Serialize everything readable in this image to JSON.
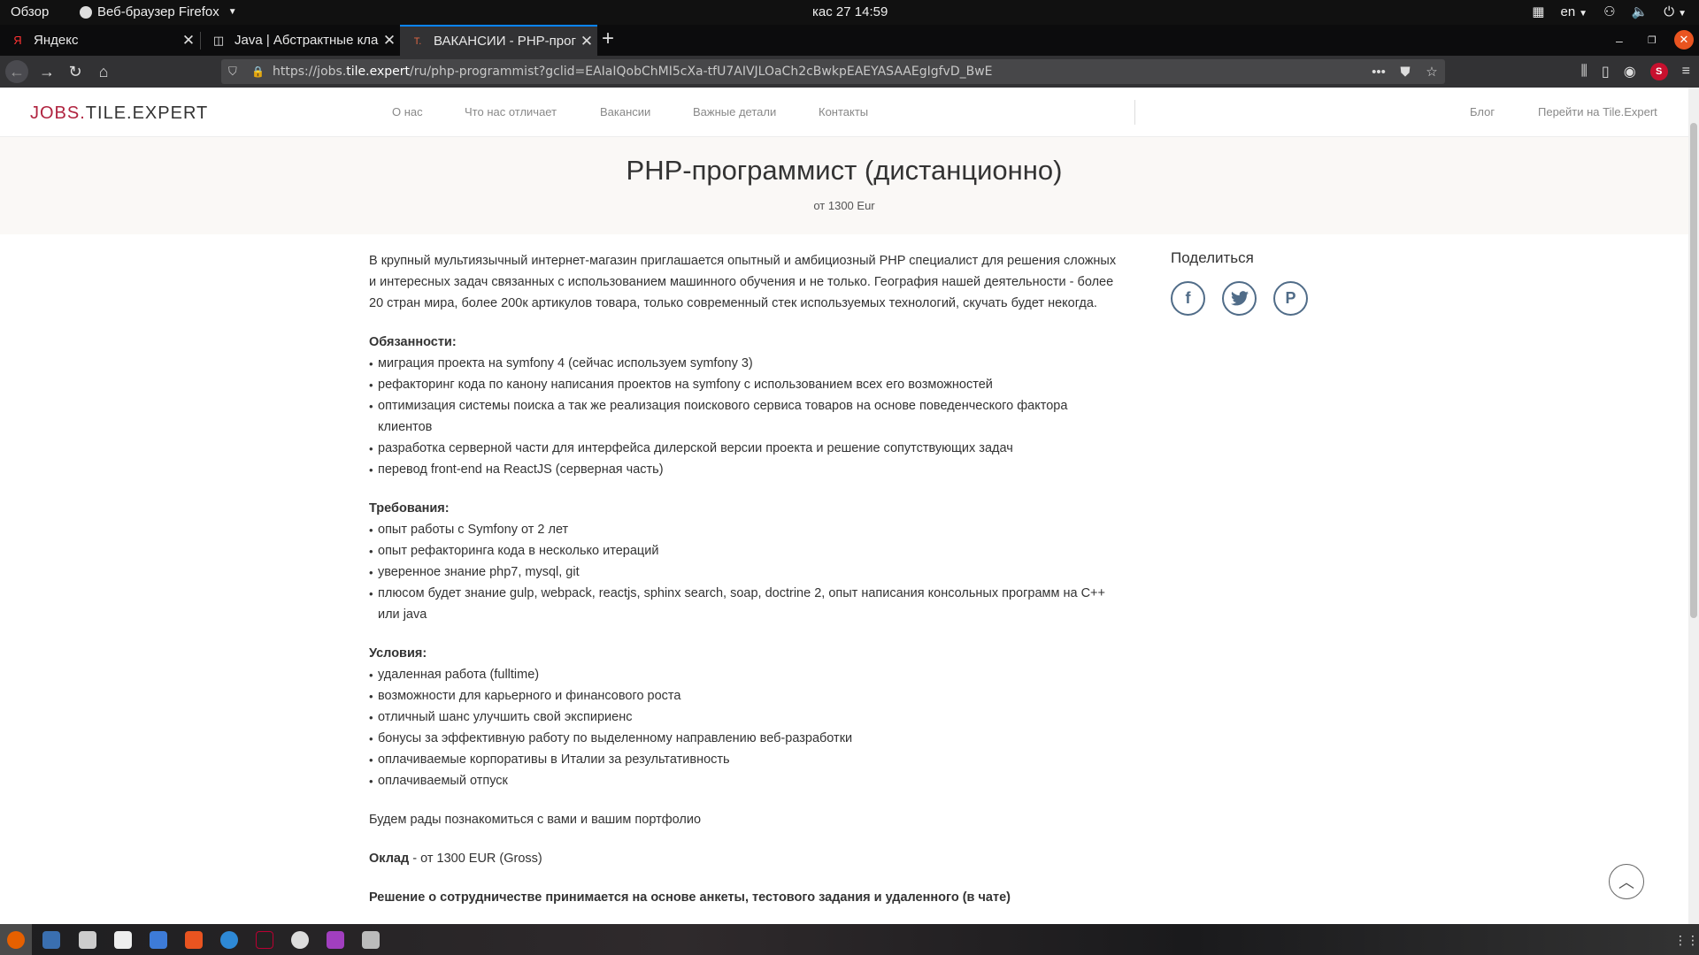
{
  "topbar": {
    "overview": "Обзор",
    "app_name": "Веб-браузер Firefox",
    "clock": "кас 27  14:59",
    "lang": "en"
  },
  "tabs": [
    {
      "title": "Яндекс",
      "favicon": "Я"
    },
    {
      "title": "Java | Абстрактные кла",
      "favicon": "◫"
    },
    {
      "title": "ВАКАНСИИ - PHP-прогр",
      "favicon": "T."
    }
  ],
  "url": {
    "prefix": "https://jobs.",
    "domain": "tile.expert",
    "path": "/ru/php-programmist?gclid=EAIaIQobChMI5cXa-tfU7AIVJLOaCh2cBwkpEAEYASAAEgIgfvD_BwE"
  },
  "site": {
    "logo_left": "JOBS.",
    "logo_right": "TILE.EXPERT",
    "menu": [
      "О нас",
      "Что нас отличает",
      "Вакансии",
      "Важные детали",
      "Контакты"
    ],
    "menu_right": [
      "Блог",
      "Перейти на Tile.Expert"
    ]
  },
  "hero": {
    "title": "PHP-программист (дистанционно)",
    "salary": "от 1300 Eur"
  },
  "content": {
    "intro": "В крупный мультиязычный интернет-магазин приглашается опытный и амбициозный PHP специалист для решения сложных и интересных задач связанных с использованием машинного обучения и не только. География нашей деятельности - более 20 стран мира, более 200к артикулов товара, только современный стек используемых технологий, скучать будет некогда.",
    "duties_title": "Обязанности:",
    "duties": [
      "миграция проекта на symfony 4 (сейчас используем symfony 3)",
      "рефакторинг кода по канону написания проектов на symfony с использованием всех его возможностей",
      "оптимизация системы поиска а так же реализация поискового сервиса товаров на основе поведенческого фактора клиентов",
      "разработка серверной части для интерфейса дилерской версии проекта и решение сопутствующих задач",
      "перевод front-end на ReactJS (серверная часть)"
    ],
    "req_title": "Требования:",
    "requirements": [
      "опыт работы с Symfony от 2 лет",
      "опыт рефакторинга кода в несколько итераций",
      "уверенное знание php7, mysql, git",
      "плюсом будет знание gulp, webpack, reactjs, sphinx search, soap, doctrine 2, опыт написания консольных программ на C++ или java"
    ],
    "cond_title": "Условия:",
    "conditions": [
      "удаленная работа (fulltime)",
      "возможности для карьерного и финансового роста",
      "отличный шанс улучшить свой экспириенс",
      "бонусы за эффективную работу по выделенному направлению веб-разработки",
      "оплачиваемые корпоративы в Италии за результативность",
      "оплачиваемый отпуск"
    ],
    "outro": "Будем рады познакомиться с вами и вашим портфолио",
    "salary_label": "Оклад",
    "salary_value": " - от 1300 EUR (Gross)",
    "decision": "Решение о сотрудничестве принимается на основе анкеты, тестового задания и удаленного (в чате)"
  },
  "share": {
    "title": "Поделиться",
    "icons": [
      "facebook-icon",
      "twitter-icon",
      "pinterest-icon"
    ]
  },
  "colors": {
    "accent": "#0a84ff",
    "brand": "#b0233f",
    "share": "#506c88"
  }
}
